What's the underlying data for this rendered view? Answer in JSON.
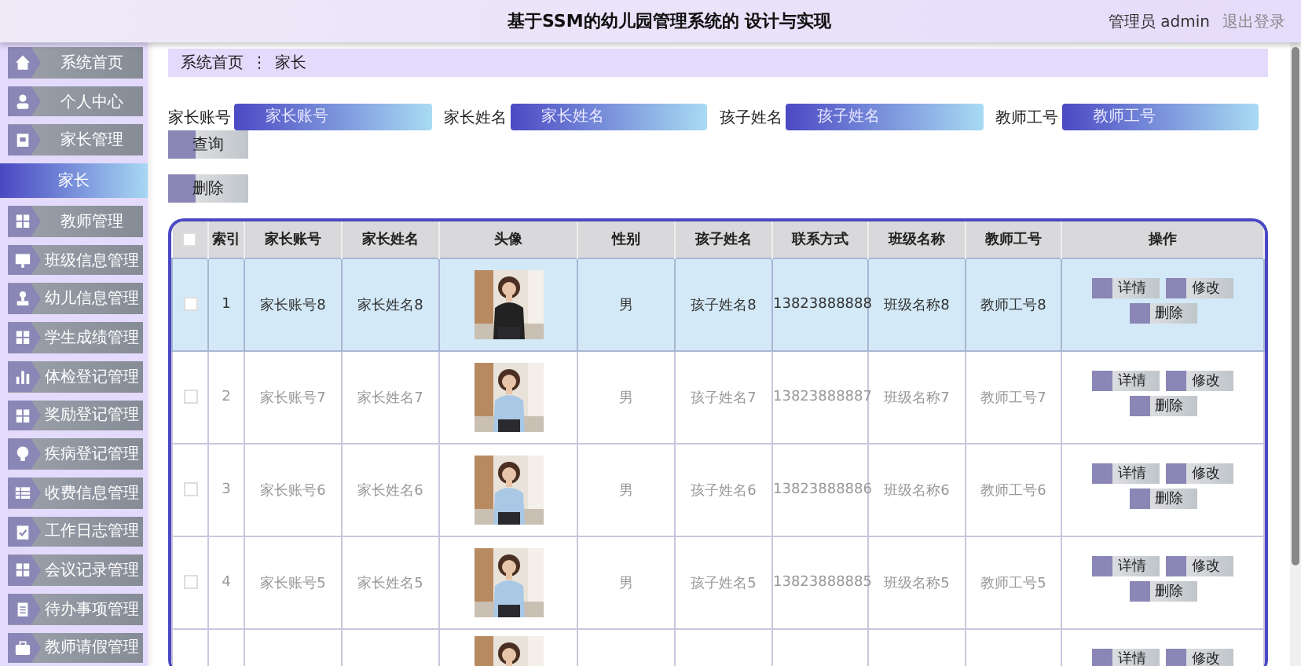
{
  "header": {
    "title": "基于SSM的幼儿园管理系统的 设计与实现",
    "user": "管理员 admin",
    "logout": "退出登录"
  },
  "sidebar": {
    "items": [
      {
        "label": "系统首页",
        "selected": false
      },
      {
        "label": "个人中心",
        "selected": false
      },
      {
        "label": "家长管理",
        "selected": false
      },
      {
        "label": "家长",
        "selected": true
      },
      {
        "label": "教师管理",
        "selected": false
      },
      {
        "label": "班级信息管理",
        "selected": false
      },
      {
        "label": "幼儿信息管理",
        "selected": false
      },
      {
        "label": "学生成绩管理",
        "selected": false
      },
      {
        "label": "体检登记管理",
        "selected": false
      },
      {
        "label": "奖励登记管理",
        "selected": false
      },
      {
        "label": "疾病登记管理",
        "selected": false
      },
      {
        "label": "收费信息管理",
        "selected": false
      },
      {
        "label": "工作日志管理",
        "selected": false
      },
      {
        "label": "会议记录管理",
        "selected": false
      },
      {
        "label": "待办事项管理",
        "selected": false
      },
      {
        "label": "教师请假管理",
        "selected": false
      }
    ]
  },
  "breadcrumb": [
    "系统首页",
    "⋮",
    "家长"
  ],
  "search": {
    "fields": [
      {
        "label": "家长账号",
        "placeholder": "家长账号"
      },
      {
        "label": "家长姓名",
        "placeholder": "家长姓名"
      },
      {
        "label": "孩子姓名",
        "placeholder": "孩子姓名"
      },
      {
        "label": "教师工号",
        "placeholder": "教师工号"
      }
    ],
    "query_button": "查询",
    "delete_button": "删除"
  },
  "table": {
    "select_all_checked": false,
    "columns": [
      "索引",
      "家长账号",
      "家长姓名",
      "头像",
      "性别",
      "孩子姓名",
      "联系方式",
      "班级名称",
      "教师工号",
      "操作"
    ],
    "rows": [
      {
        "selected": true,
        "checked": false,
        "index": "1",
        "account": "家长账号8",
        "name": "家长姓名8",
        "gender": "男",
        "child": "孩子姓名8",
        "phone": "13823888888",
        "class": "班级名称8",
        "teacher": "教师工号8",
        "actions": [
          "详情",
          "修改",
          "删除"
        ]
      },
      {
        "selected": false,
        "checked": false,
        "index": "2",
        "account": "家长账号7",
        "name": "家长姓名7",
        "gender": "男",
        "child": "孩子姓名7",
        "phone": "13823888887",
        "class": "班级名称7",
        "teacher": "教师工号7",
        "actions": [
          "详情",
          "修改",
          "删除"
        ]
      },
      {
        "selected": false,
        "checked": false,
        "index": "3",
        "account": "家长账号6",
        "name": "家长姓名6",
        "gender": "男",
        "child": "孩子姓名6",
        "phone": "13823888886",
        "class": "班级名称6",
        "teacher": "教师工号6",
        "actions": [
          "详情",
          "修改",
          "删除"
        ]
      },
      {
        "selected": false,
        "checked": false,
        "index": "4",
        "account": "家长账号5",
        "name": "家长姓名5",
        "gender": "男",
        "child": "孩子姓名5",
        "phone": "13823888885",
        "class": "班级名称5",
        "teacher": "教师工号5",
        "actions": [
          "详情",
          "修改",
          "删除"
        ]
      },
      {
        "selected": false,
        "actions": [
          "详情",
          "修改"
        ]
      }
    ]
  }
}
